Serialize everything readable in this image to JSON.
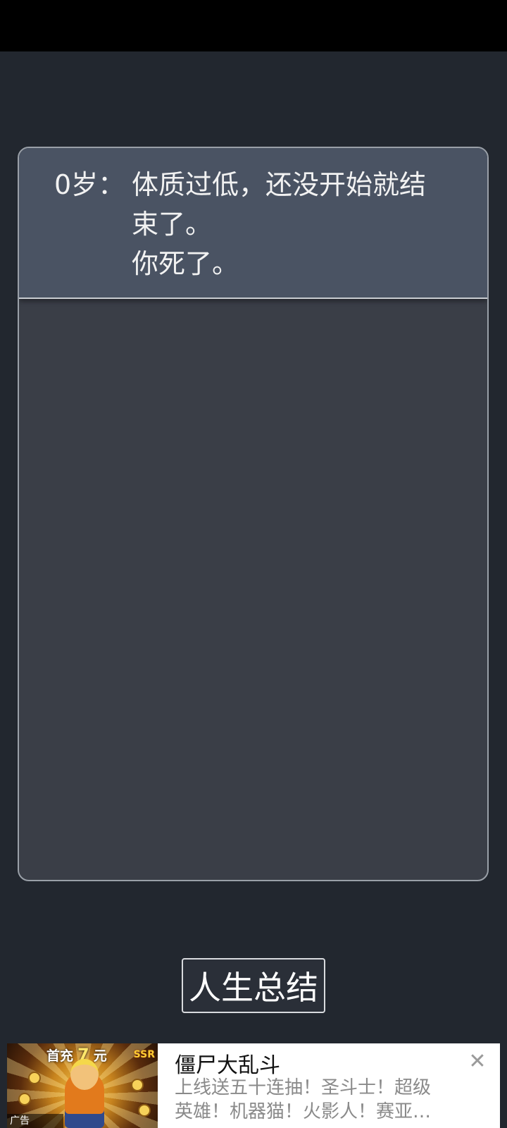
{
  "log": {
    "entries": [
      {
        "age": "0岁：",
        "lines": [
          "体质过低，还没开始就结",
          "束了。",
          "你死了。"
        ]
      }
    ]
  },
  "summary_button_label": "人生总结",
  "ad": {
    "thumbnail": {
      "top_text_a": "首充",
      "top_text_num": "7",
      "top_text_b": "元",
      "ssr": "SSR",
      "badge": "广告"
    },
    "title": "僵尸大乱斗",
    "description_lines": [
      "上线送五十连抽！圣斗士！超级",
      "英雄！机器猫！火影人！赛亚…"
    ],
    "close_icon": "close-icon"
  },
  "colors": {
    "background": "#22272f",
    "panel": "#3a3e47",
    "entry": "#4a5363"
  }
}
